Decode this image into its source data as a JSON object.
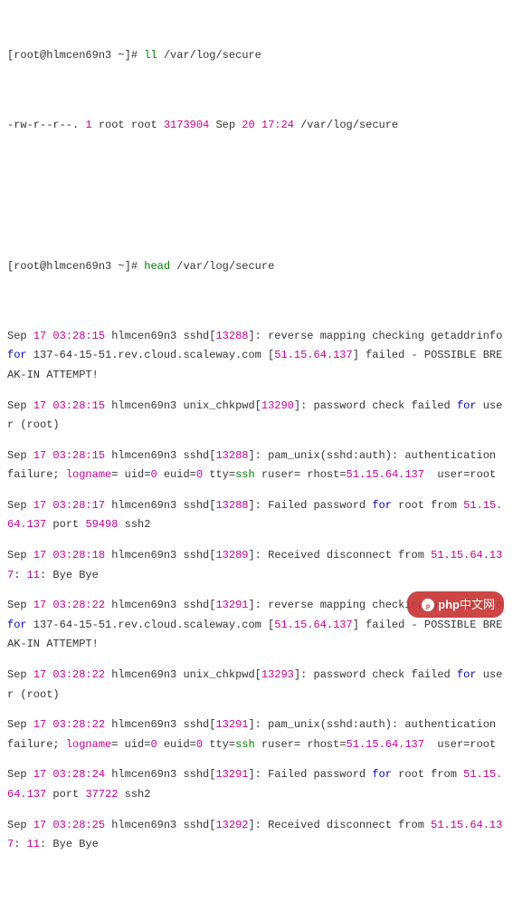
{
  "prompt1": {
    "open": "[",
    "user": "root@hlmcen69n3",
    "tilde": " ~]# ",
    "cmd": "ll",
    "arg": " /var/log/secure"
  },
  "ls": {
    "perm": "-rw-r--r--.",
    "links": "1",
    "owner": "root root",
    "size": "3173904",
    "mon": "Sep",
    "day": "20",
    "time": "17:24",
    "path": "/var/log/secure"
  },
  "prompt2": {
    "open": "[",
    "user": "root@hlmcen69n3",
    "tilde": " ~]# ",
    "cmd": "head",
    "arg": " /var/log/secure"
  },
  "lines": [
    {
      "mon": "Sep",
      "d": "17",
      "t": "03:28:15",
      "h": "hlmcen69n3",
      "proc": "sshd[",
      "pid": "13288",
      "pb": "]:",
      "msg1": " reverse mapping checking getaddrinfo ",
      "kw": "for",
      "msg2": " 137-64-15-51.rev.cloud.scaleway.com [",
      "ip": "51.15.64.137",
      "msg3": "] failed - POSSIBLE BREAK-IN ATTEMPT!"
    },
    {
      "mon": "Sep",
      "d": "17",
      "t": "03:28:15",
      "h": "hlmcen69n3",
      "proc": "unix_chkpwd[",
      "pid": "13290",
      "pb": "]:",
      "msg1": " password check failed ",
      "kw": "for",
      "msg2": " user (root)"
    },
    {
      "mon": "Sep",
      "d": "17",
      "t": "03:28:15",
      "h": "hlmcen69n3",
      "proc": "sshd[",
      "pid": "13288",
      "pb": "]:",
      "msg1": " pam_unix(sshd:auth): authentication failure; ",
      "logname": "logname",
      "msg2": "= uid=",
      "u0": "0",
      "msg3": " euid=",
      "u1": "0",
      "msg4": " tty=",
      "ssh": "ssh",
      "msg5": " ruser= rhost=",
      "ip": "51.15.64.137",
      "msg6": "  user=root"
    },
    {
      "mon": "Sep",
      "d": "17",
      "t": "03:28:17",
      "h": "hlmcen69n3",
      "proc": "sshd[",
      "pid": "13288",
      "pb": "]:",
      "msg1": " Failed password ",
      "kw": "for",
      "msg2": " root from ",
      "ip": "51.15.64.137",
      "msg3": " port ",
      "port": "59498",
      "msg4": " ssh2"
    },
    {
      "mon": "Sep",
      "d": "17",
      "t": "03:28:18",
      "h": "hlmcen69n3",
      "proc": "sshd[",
      "pid": "13289",
      "pb": "]:",
      "msg1": " Received disconnect from ",
      "ip": "51.15.64.137",
      "msg2": ": ",
      "c": "11",
      "msg3": ": Bye Bye"
    },
    {
      "mon": "Sep",
      "d": "17",
      "t": "03:28:22",
      "h": "hlmcen69n3",
      "proc": "sshd[",
      "pid": "13291",
      "pb": "]:",
      "msg1": " reverse mapping checking getaddrinfo ",
      "kw": "for",
      "msg2": " 137-64-15-51.rev.cloud.scaleway.com [",
      "ip": "51.15.64.137",
      "msg3": "] failed - POSSIBLE BREAK-IN ATTEMPT!"
    },
    {
      "mon": "Sep",
      "d": "17",
      "t": "03:28:22",
      "h": "hlmcen69n3",
      "proc": "unix_chkpwd[",
      "pid": "13293",
      "pb": "]:",
      "msg1": " password check failed ",
      "kw": "for",
      "msg2": " user (root)"
    },
    {
      "mon": "Sep",
      "d": "17",
      "t": "03:28:22",
      "h": "hlmcen69n3",
      "proc": "sshd[",
      "pid": "13291",
      "pb": "]:",
      "msg1": " pam_unix(sshd:auth): authentication failure; ",
      "logname": "logname",
      "msg2": "= uid=",
      "u0": "0",
      "msg3": " euid=",
      "u1": "0",
      "msg4": " tty=",
      "ssh": "ssh",
      "msg5": " ruser= rhost=",
      "ip": "51.15.64.137",
      "msg6": "  user=root"
    },
    {
      "mon": "Sep",
      "d": "17",
      "t": "03:28:24",
      "h": "hlmcen69n3",
      "proc": "sshd[",
      "pid": "13291",
      "pb": "]:",
      "msg1": " Failed password ",
      "kw": "for",
      "msg2": " root from ",
      "ip": "51.15.64.137",
      "msg3": " port ",
      "port": "37722",
      "msg4": " ssh2"
    },
    {
      "mon": "Sep",
      "d": "17",
      "t": "03:28:25",
      "h": "hlmcen69n3",
      "proc": "sshd[",
      "pid": "13292",
      "pb": "]:",
      "msg1": " Received disconnect from ",
      "ip": "51.15.64.137",
      "msg2": ": ",
      "c": "11",
      "msg3": ": Bye Bye"
    }
  ],
  "watermark": {
    "brand": "php",
    "cn": "中文网"
  }
}
